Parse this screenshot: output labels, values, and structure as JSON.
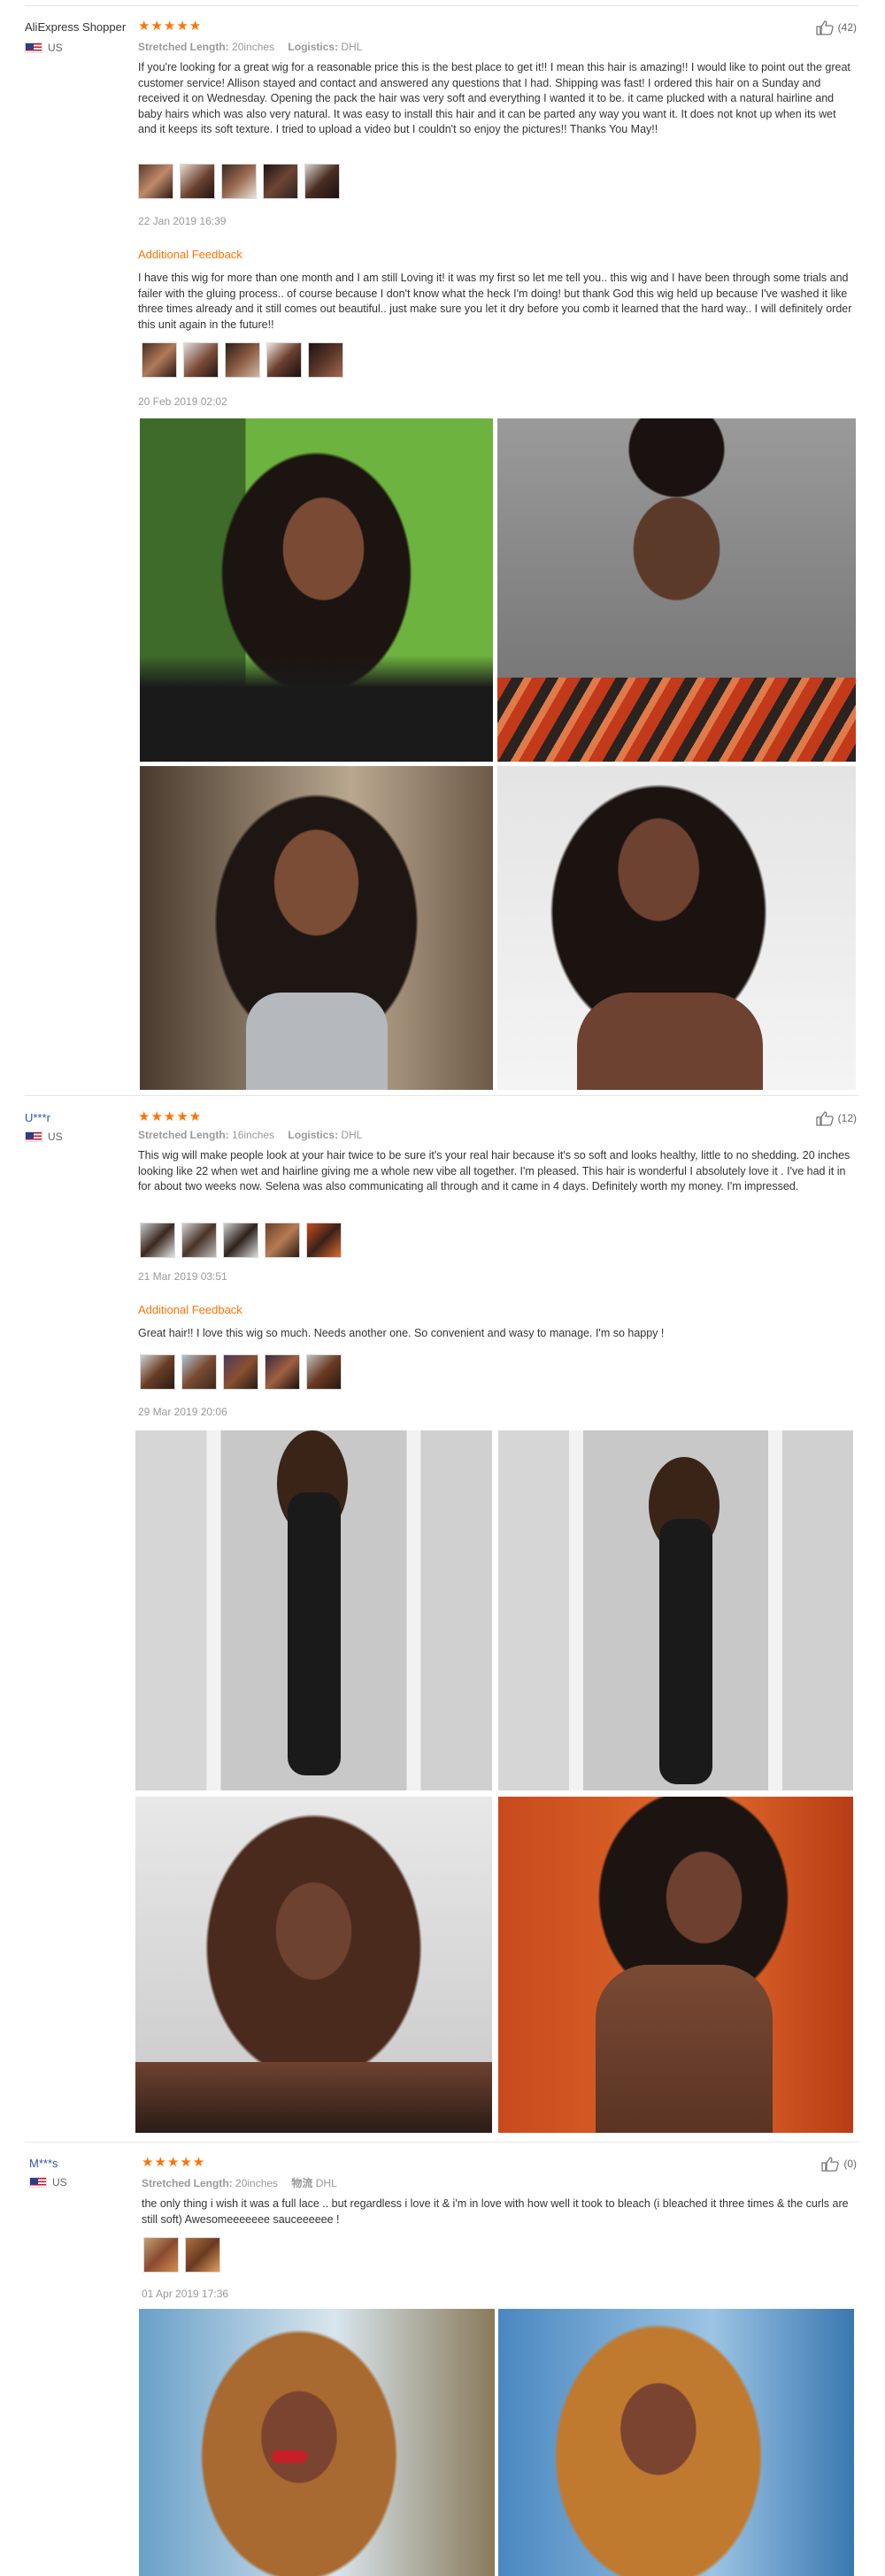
{
  "labels": {
    "additional_feedback": "Additional Feedback",
    "stretched_length": "Stretched Length:",
    "logistics": "Logistics:"
  },
  "reviews": [
    {
      "user": "AliExpress Shopper",
      "country": "US",
      "rating": "★★★★★",
      "likes": "(42)",
      "length": "20inches",
      "logistics_label": "Logistics:",
      "logistics": "DHL",
      "text": "If you're looking for a great wig for a reasonable price this is the best place to get it!! I mean this hair is amazing!! I would like to point out the great customer service! Allison stayed and contact and answered any questions that I had. Shipping was fast! I ordered this hair on a Sunday and received it on Wednesday. Opening the pack the hair was very soft and everything I wanted it to be. it came plucked with a natural hairline and baby hairs which was also very natural. It was easy to install this hair and it can be parted any way you want it. It does not knot up when its wet and it keeps its soft texture. I tried to upload a video but I couldn't so enjoy the pictures!! Thanks You May!!",
      "date": "22 Jan 2019 16:39",
      "additional_text": "I have this wig for more than one month and I am still Loving it! it was my first so let me tell you.. this wig and I have been through some trials and failer with the gluing process.. of course because I don't know what the heck I'm doing! but thank God this wig held up because I've washed it like three times already and it still comes out beautiful.. just make sure you let it dry before you comb it learned that the hard way.. I will definitely order this unit again in the future!!",
      "additional_date": "20 Feb 2019 02:02"
    },
    {
      "user": "U***r",
      "country": "US",
      "rating": "★★★★★",
      "likes": "(12)",
      "length": "16inches",
      "logistics_label": "Logistics:",
      "logistics": "DHL",
      "text": "This wig will make people look at your hair twice to be sure it's your real hair because it's so soft and looks healthy, little to no shedding. 20 inches looking like 22 when wet and hairline giving me a whole new vibe all together. I'm pleased. This hair is wonderful I absolutely love it . I've had it in for about two weeks now. Selena was also communicating all through and it came in 4 days. Definitely worth my money. I'm impressed.",
      "date": "21 Mar 2019 03:51",
      "additional_text": "Great hair!! I love this wig so much. Needs another one. So convenient and wasy to manage. I'm so happy !",
      "additional_date": "29 Mar 2019 20:06"
    },
    {
      "user": "M***s",
      "country": "US",
      "rating": "★★★★★",
      "likes": "(0)",
      "length": "20inches",
      "logistics_label": "物流",
      "logistics": "DHL",
      "text": "the only thing i wish it was a full lace .. but regardless i love it & i'm in love with how well it took to bleach (i bleached it three times & the curls are still soft) Awesomeeeeeee sauceeeeee !",
      "date": "01 Apr 2019 17:36"
    }
  ],
  "colors": {
    "accent": "#ff7300",
    "link": "#2d56a8",
    "muted": "#999999",
    "divider": "#e6e6e6"
  },
  "icons": [
    "thumbs-up-icon",
    "us-flag-icon",
    "star-icon"
  ]
}
